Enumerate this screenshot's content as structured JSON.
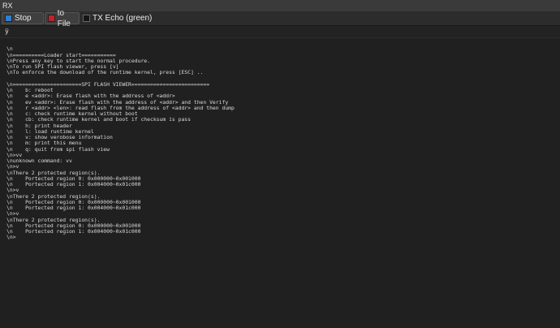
{
  "window": {
    "title": "RX"
  },
  "toolbar": {
    "stop_label": "Stop",
    "stop_icon": "stop-icon",
    "stop_icon_color": "#2f7fd1",
    "file_label": "to File",
    "file_icon": "record-icon",
    "file_icon_color": "#c0222c",
    "echo_label": "TX Echo (green)",
    "echo_checked": false
  },
  "input": {
    "value": "ÿ"
  },
  "terminal": {
    "lines": [
      "",
      "\\n",
      "\\n==========Loader start===========",
      "\\nPress any key to start the normal procedure.",
      "\\nTo run SPI flash viewer, press [v]",
      "\\nTo enforce the download of the runtime kernel, press [ESC] ..",
      "",
      "\\n======================SPI FLASH VIEWER=========================",
      "\\n    b: reboot",
      "\\n    e <addr>: Erase flash with the address of <addr>",
      "\\n    ev <addr>: Erase flash with the address of <addr> and then Verify",
      "\\n    r <addr> <len>: read flash from the address of <addr> and then dump",
      "\\n    c: check runtime kernel without boot",
      "\\n    cb: check runtime kernel and boot if checksum is pass",
      "\\n    h: print header",
      "\\n    l: load runtime kernel",
      "\\n    v: show verobose information",
      "\\n    m: print this menu",
      "\\n    q: quit from spi flash view",
      "\\n>vv",
      "\\nunknown command: vv",
      "\\n>v",
      "\\nThere 2 protected region(s).",
      "\\n    Portected region 0: 0x000000~0x001000",
      "\\n    Portected region 1: 0x004000~0x01c000",
      "\\n>v",
      "\\nThere 2 protected region(s).",
      "\\n    Portected region 0: 0x000000~0x001000",
      "\\n    Portected region 1: 0x004000~0x01c000",
      "\\n>v",
      "\\nThere 2 protected region(s).",
      "\\n    Portected region 0: 0x000000~0x001000",
      "\\n    Portected region 1: 0x004000~0x01c000",
      "\\n>"
    ]
  }
}
